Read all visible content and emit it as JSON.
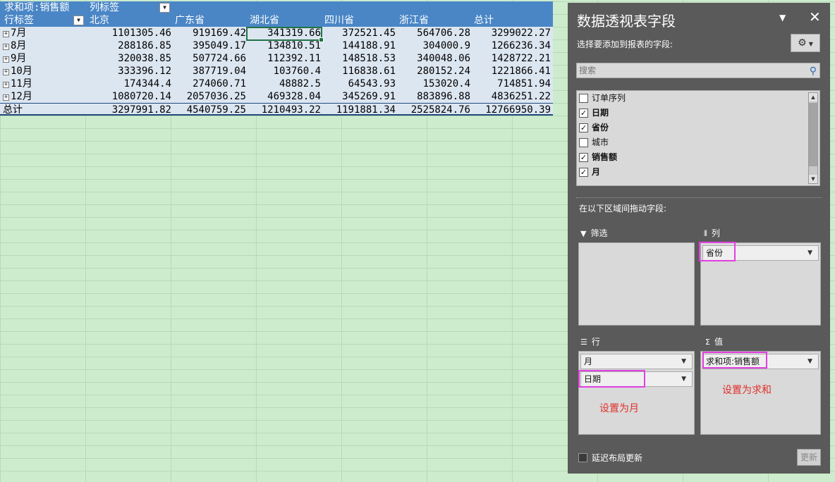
{
  "pivot": {
    "value_label": "求和项:销售额",
    "col_label": "列标签",
    "row_label": "行标签",
    "columns": [
      "北京",
      "广东省",
      "湖北省",
      "四川省",
      "浙江省",
      "总计"
    ],
    "rows": [
      {
        "label": "7月",
        "values": [
          "1101305.46",
          "919169.42",
          "341319.66",
          "372521.45",
          "564706.28",
          "3299022.27"
        ]
      },
      {
        "label": "8月",
        "values": [
          "288186.85",
          "395049.17",
          "134810.51",
          "144188.91",
          "304000.9",
          "1266236.34"
        ]
      },
      {
        "label": "9月",
        "values": [
          "320038.85",
          "507724.66",
          "112392.11",
          "148518.53",
          "340048.06",
          "1428722.21"
        ]
      },
      {
        "label": "10月",
        "values": [
          "333396.12",
          "387719.04",
          "103760.4",
          "116838.61",
          "280152.24",
          "1221866.41"
        ]
      },
      {
        "label": "11月",
        "values": [
          "174344.4",
          "274060.71",
          "48882.5",
          "64543.93",
          "153020.4",
          "714851.94"
        ]
      },
      {
        "label": "12月",
        "values": [
          "1080720.14",
          "2057036.25",
          "469328.04",
          "345269.91",
          "883896.88",
          "4836251.22"
        ]
      }
    ],
    "total": {
      "label": "总计",
      "values": [
        "3297991.82",
        "4540759.25",
        "1210493.22",
        "1191881.34",
        "2525824.76",
        "12766950.39"
      ]
    }
  },
  "pane": {
    "title": "数据透视表字段",
    "choose_label": "选择要添加到报表的字段:",
    "search_placeholder": "搜索",
    "fields": [
      {
        "label": "订单序列",
        "checked": false
      },
      {
        "label": "日期",
        "checked": true
      },
      {
        "label": "省份",
        "checked": true
      },
      {
        "label": "城市",
        "checked": false
      },
      {
        "label": "销售额",
        "checked": true
      },
      {
        "label": "月",
        "checked": true
      }
    ],
    "drag_label": "在以下区域间拖动字段:",
    "areas": {
      "filter": {
        "title": "筛选",
        "chips": []
      },
      "columns": {
        "title": "列",
        "chips": [
          "省份"
        ]
      },
      "rows": {
        "title": "行",
        "chips": [
          "月",
          "日期"
        ]
      },
      "values": {
        "title": "值",
        "chips": [
          "求和项:销售额"
        ]
      }
    },
    "notes": {
      "rows": "设置为月",
      "values": "设置为求和"
    },
    "defer_label": "延迟布局更新",
    "update_label": "更新"
  },
  "colors": {
    "accent": "#4a86c6",
    "highlight": "#e040e0",
    "note": "#e0302a",
    "sheet": "#cdeccd"
  },
  "icons": [
    "filter-dropdown-icon",
    "expand-icon",
    "search-icon",
    "gear-icon",
    "close-icon",
    "funnel-icon",
    "columns-icon",
    "rows-icon",
    "sigma-icon"
  ]
}
